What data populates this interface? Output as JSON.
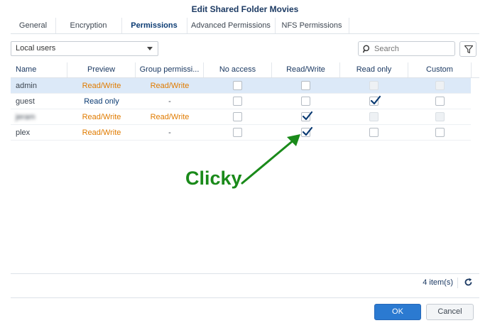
{
  "window": {
    "title": "Edit Shared Folder Movies"
  },
  "tabs": [
    {
      "label": "General"
    },
    {
      "label": "Encryption"
    },
    {
      "label": "Permissions",
      "active": true
    },
    {
      "label": "Advanced Permissions"
    },
    {
      "label": "NFS Permissions"
    }
  ],
  "toolbar": {
    "user_type": "Local users",
    "search_placeholder": "Search"
  },
  "table": {
    "headers": [
      "Name",
      "Preview",
      "Group permissi...",
      "No access",
      "Read/Write",
      "Read only",
      "Custom"
    ],
    "rows": [
      {
        "name": "admin",
        "preview": "Read/Write",
        "group": "Read/Write",
        "no_access": false,
        "read_write": false,
        "read_only": false,
        "custom": false,
        "selected": true
      },
      {
        "name": "guest",
        "preview": "Read only",
        "group": "-",
        "no_access": false,
        "read_write": false,
        "read_only": true,
        "custom": false
      },
      {
        "name": "jeram",
        "preview": "Read/Write",
        "group": "Read/Write",
        "no_access": false,
        "read_write": true,
        "read_only": false,
        "custom": false
      },
      {
        "name": "plex",
        "preview": "Read/Write",
        "group": "-",
        "no_access": false,
        "read_write": true,
        "read_only": false,
        "custom": false
      }
    ]
  },
  "annotation": {
    "text": "Clicky",
    "color": "#1a8a1a"
  },
  "footer": {
    "count": "4 item(s)"
  },
  "buttons": {
    "ok": "OK",
    "cancel": "Cancel"
  },
  "colors": {
    "accent": "#2b7ad1",
    "read_write": "#e07b00",
    "read_only": "#0b3b73"
  }
}
